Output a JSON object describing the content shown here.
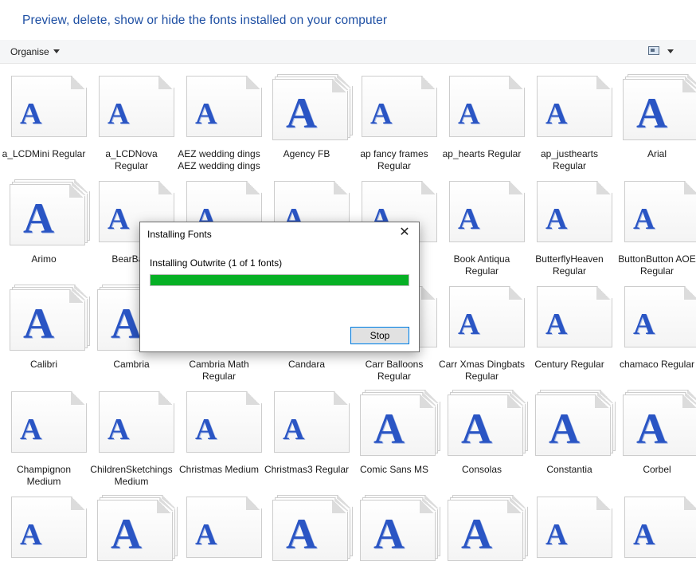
{
  "header": {
    "title": "Preview, delete, show or hide the fonts installed on your computer"
  },
  "toolbar": {
    "organise_label": "Organise"
  },
  "icons": {
    "font_glyph": "A",
    "accent": "#2a55c4"
  },
  "fonts": [
    {
      "name": "a_LCDMini Regular",
      "family": false
    },
    {
      "name": "a_LCDNova Regular",
      "family": false
    },
    {
      "name": "AEZ wedding dings AEZ wedding dings",
      "family": false
    },
    {
      "name": "Agency FB",
      "family": true
    },
    {
      "name": "ap fancy frames Regular",
      "family": false
    },
    {
      "name": "ap_hearts Regular",
      "family": false
    },
    {
      "name": "ap_justhearts Regular",
      "family": false
    },
    {
      "name": "Arial",
      "family": true
    },
    {
      "name": "Arimo",
      "family": true
    },
    {
      "name": "BearBats",
      "family": false
    },
    {
      "name": "",
      "family": false
    },
    {
      "name": "",
      "family": false
    },
    {
      "name": "y",
      "family": false
    },
    {
      "name": "Book Antiqua Regular",
      "family": false
    },
    {
      "name": "ButterflyHeaven Regular",
      "family": false
    },
    {
      "name": "ButtonButton AOE Regular",
      "family": false
    },
    {
      "name": "Calibri",
      "family": true
    },
    {
      "name": "Cambria",
      "family": true
    },
    {
      "name": "Cambria Math Regular",
      "family": false
    },
    {
      "name": "Candara",
      "family": true
    },
    {
      "name": "Carr Balloons Regular",
      "family": false
    },
    {
      "name": "Carr Xmas Dingbats Regular",
      "family": false
    },
    {
      "name": "Century Regular",
      "family": false
    },
    {
      "name": "chamaco Regular",
      "family": false
    },
    {
      "name": "Champignon Medium",
      "family": false
    },
    {
      "name": "ChildrenSketchings Medium",
      "family": false
    },
    {
      "name": "Christmas Medium",
      "family": false
    },
    {
      "name": "Christmas3 Regular",
      "family": false
    },
    {
      "name": "Comic Sans MS",
      "family": true
    },
    {
      "name": "Consolas",
      "family": true
    },
    {
      "name": "Constantia",
      "family": true
    },
    {
      "name": "Corbel",
      "family": true
    },
    {
      "name": "",
      "family": false
    },
    {
      "name": "",
      "family": true
    },
    {
      "name": "",
      "family": false
    },
    {
      "name": "",
      "family": true
    },
    {
      "name": "",
      "family": true
    },
    {
      "name": "",
      "family": true
    },
    {
      "name": "",
      "family": false
    },
    {
      "name": "",
      "family": false
    }
  ],
  "dialog": {
    "title": "Installing Fonts",
    "close_glyph": "✕",
    "status": "Installing Outwrite (1 of 1 fonts)",
    "progress_fraction": 1.0,
    "stop_label": "Stop"
  }
}
